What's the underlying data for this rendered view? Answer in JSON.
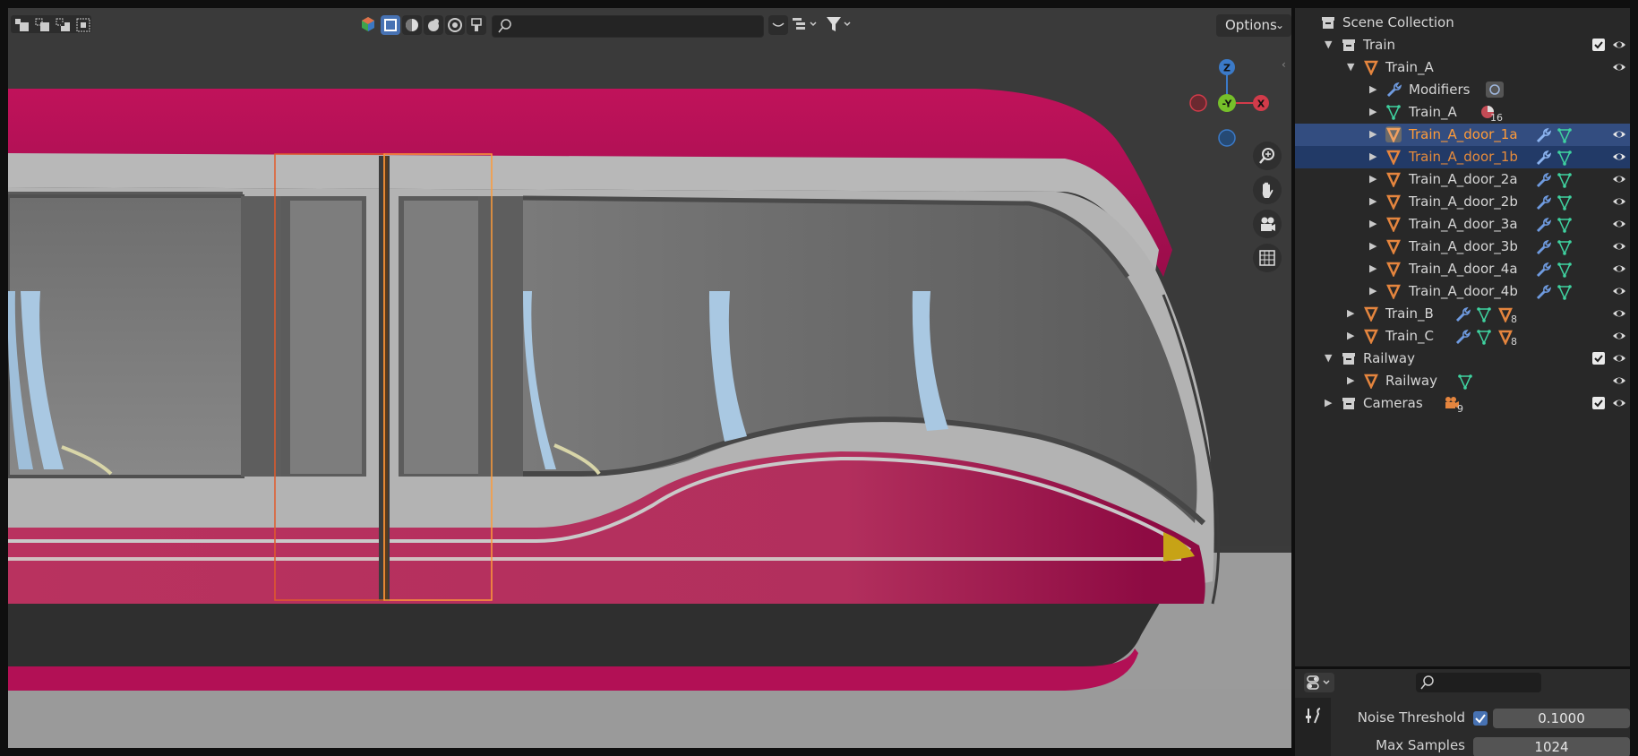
{
  "viewport": {
    "header": {
      "select_mode_icons": [
        "select-box-new-icon",
        "select-box-extend-icon",
        "select-box-subtract-icon",
        "select-box-intersect-icon"
      ],
      "shading_icons": [
        "shading-solid-icon",
        "shading-wireframe-icon",
        "shading-material-icon",
        "shading-rendered-icon",
        "shading-texture-icon",
        "paint-icon"
      ],
      "search_value": "",
      "options_label": "Options"
    },
    "gizmo": {
      "z_label": "Z",
      "y_label": "-Y",
      "x_label": "X"
    },
    "colors": {
      "train_magenta": "#b5114f",
      "train_silver": "#b3b3b3",
      "window_gray": "#7b7b7b",
      "selection_orange": "#ff8a2b",
      "headlight_yellow": "#c7a316"
    }
  },
  "outliner": {
    "root_label": "Scene Collection",
    "items": [
      {
        "label": "Train",
        "type": "collection",
        "expanded": true
      },
      {
        "label": "Train_A",
        "type": "object",
        "expanded": true
      },
      {
        "label": "Modifiers",
        "type": "modifiers"
      },
      {
        "label": "Train_A",
        "type": "mesh",
        "badge": "16"
      },
      {
        "label": "Train_A_door_1a",
        "type": "object",
        "selected": "active"
      },
      {
        "label": "Train_A_door_1b",
        "type": "object",
        "selected": "selected"
      },
      {
        "label": "Train_A_door_2a",
        "type": "object"
      },
      {
        "label": "Train_A_door_2b",
        "type": "object"
      },
      {
        "label": "Train_A_door_3a",
        "type": "object"
      },
      {
        "label": "Train_A_door_3b",
        "type": "object"
      },
      {
        "label": "Train_A_door_4a",
        "type": "object"
      },
      {
        "label": "Train_A_door_4b",
        "type": "object"
      },
      {
        "label": "Train_B",
        "type": "object",
        "badge": "8"
      },
      {
        "label": "Train_C",
        "type": "object",
        "badge": "8"
      },
      {
        "label": "Railway",
        "type": "collection",
        "expanded": true
      },
      {
        "label": "Railway",
        "type": "object"
      },
      {
        "label": "Cameras",
        "type": "collection",
        "badge": "9"
      }
    ]
  },
  "properties": {
    "search_value": "",
    "noise_threshold_label": "Noise Threshold",
    "noise_threshold_enabled": true,
    "noise_threshold_value": "0.1000",
    "max_samples_label": "Max Samples",
    "max_samples_value": "1024"
  }
}
